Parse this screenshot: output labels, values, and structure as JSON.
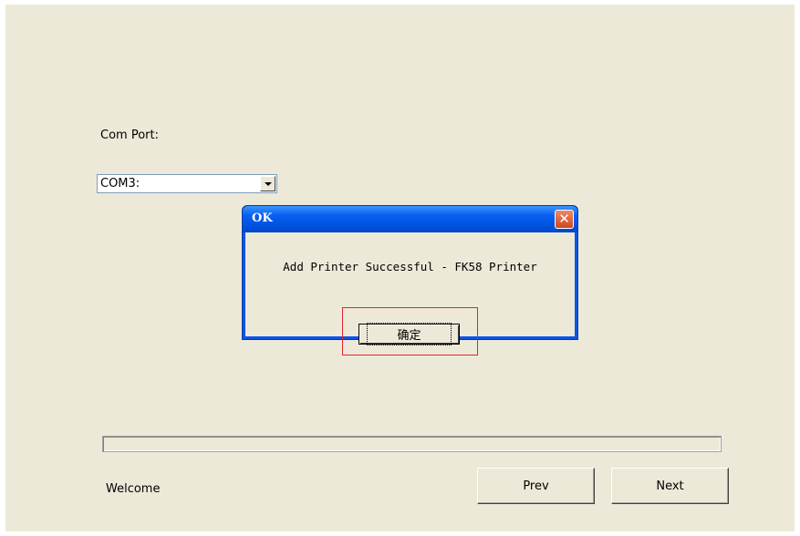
{
  "wizard": {
    "com_port_label": "Com Port:",
    "com_port_value": "COM3:",
    "status_text": "Welcome",
    "prev_label": "Prev",
    "next_label": "Next",
    "progress_fraction": 0
  },
  "dialog": {
    "title": "OK",
    "message": "Add Printer Successful - FK58 Printer",
    "ok_label": "确定",
    "close_glyph": "✕",
    "highlight_color": "#e0262b"
  },
  "colors": {
    "window_bg": "#ece9d8",
    "titlebar_blue": "#0054e3",
    "close_red": "#d2461c"
  }
}
